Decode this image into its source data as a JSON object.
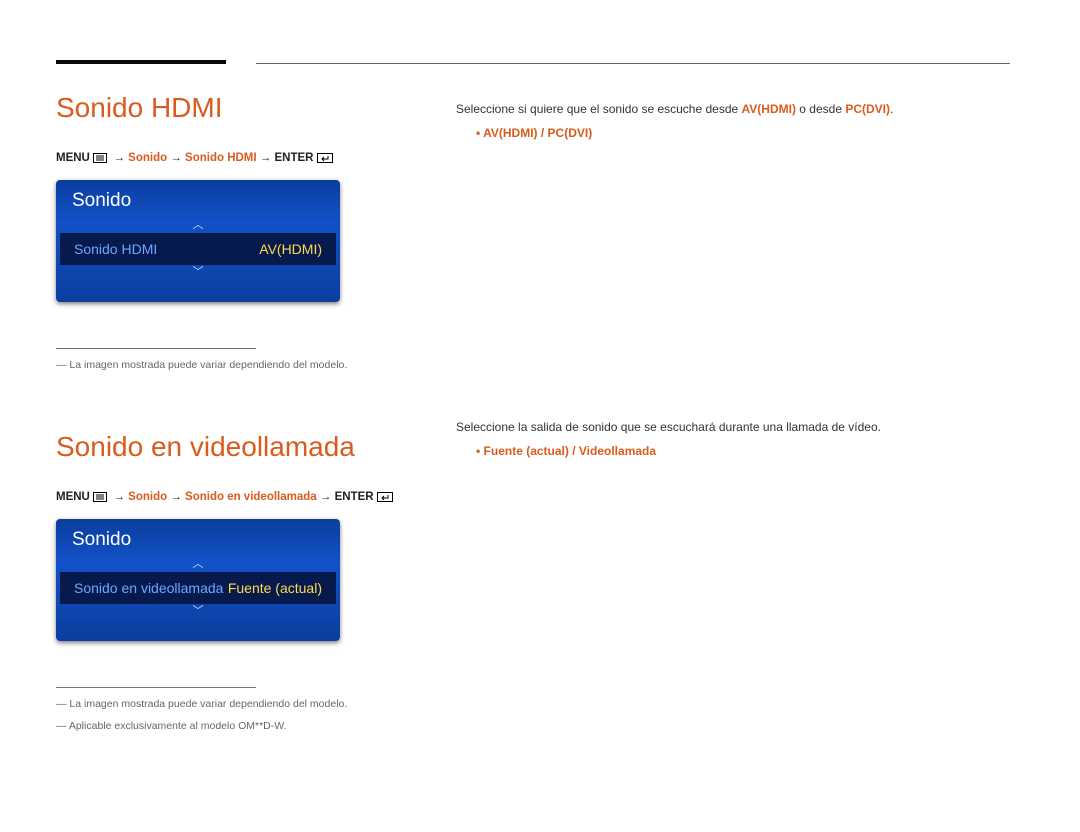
{
  "section1": {
    "heading": "Sonido HDMI",
    "breadcrumb": {
      "menu": "MENU",
      "parts": [
        "Sonido",
        "Sonido HDMI"
      ],
      "enter": "ENTER"
    },
    "osd": {
      "title": "Sonido",
      "rowLabel": "Sonido HDMI",
      "rowValue": "AV(HDMI)"
    },
    "footnotes": [
      "La imagen mostrada puede variar dependiendo del modelo."
    ],
    "right": {
      "desc_pre": "Seleccione si quiere que el sonido se escuche desde ",
      "desc_em1": "AV(HDMI)",
      "desc_mid": " o desde ",
      "desc_em2": "PC(DVI)",
      "desc_post": ".",
      "bullet": "AV(HDMI) / PC(DVI)"
    }
  },
  "section2": {
    "heading": "Sonido en videollamada",
    "breadcrumb": {
      "menu": "MENU",
      "parts": [
        "Sonido",
        "Sonido en videollamada"
      ],
      "enter": "ENTER"
    },
    "osd": {
      "title": "Sonido",
      "rowLabel": "Sonido en videollamada",
      "rowValue": "Fuente (actual)"
    },
    "footnotes": [
      "La imagen mostrada puede variar dependiendo del modelo.",
      "Aplicable exclusivamente al modelo OM**D-W."
    ],
    "right": {
      "desc": "Seleccione la salida de sonido que se escuchará durante una llamada de vídeo.",
      "bullet": "Fuente (actual) / Videollamada"
    }
  }
}
